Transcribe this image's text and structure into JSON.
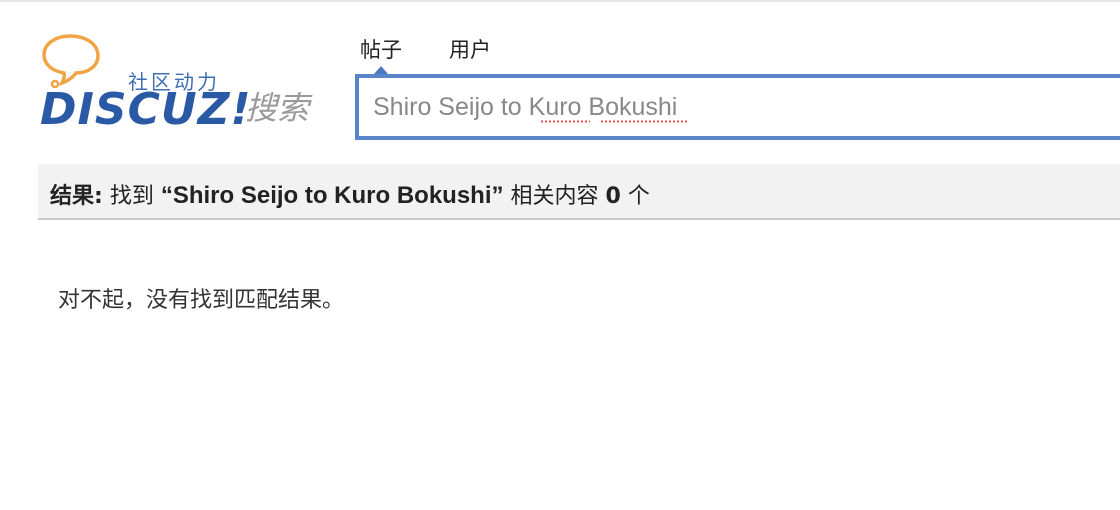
{
  "logo": {
    "tagline": "社区动力",
    "wordmark": "DISCUZ!",
    "subtitle": "搜索"
  },
  "search": {
    "tabs": [
      {
        "label": "帖子",
        "active": true
      },
      {
        "label": "用户",
        "active": false
      }
    ],
    "query": "Shiro Seijo to Kuro Bokushi"
  },
  "result": {
    "prefix": "结果:",
    "found": "找到",
    "query_quoted": "“Shiro Seijo to Kuro Bokushi”",
    "related": "相关内容",
    "count": "0",
    "unit": "个"
  },
  "message": {
    "no_results": "对不起，没有找到匹配结果。"
  },
  "colors": {
    "accent": "#5a86c9",
    "logo_blue": "#2a5aa6",
    "logo_orange": "#f0a444",
    "result_bg": "#f2f2f2"
  }
}
